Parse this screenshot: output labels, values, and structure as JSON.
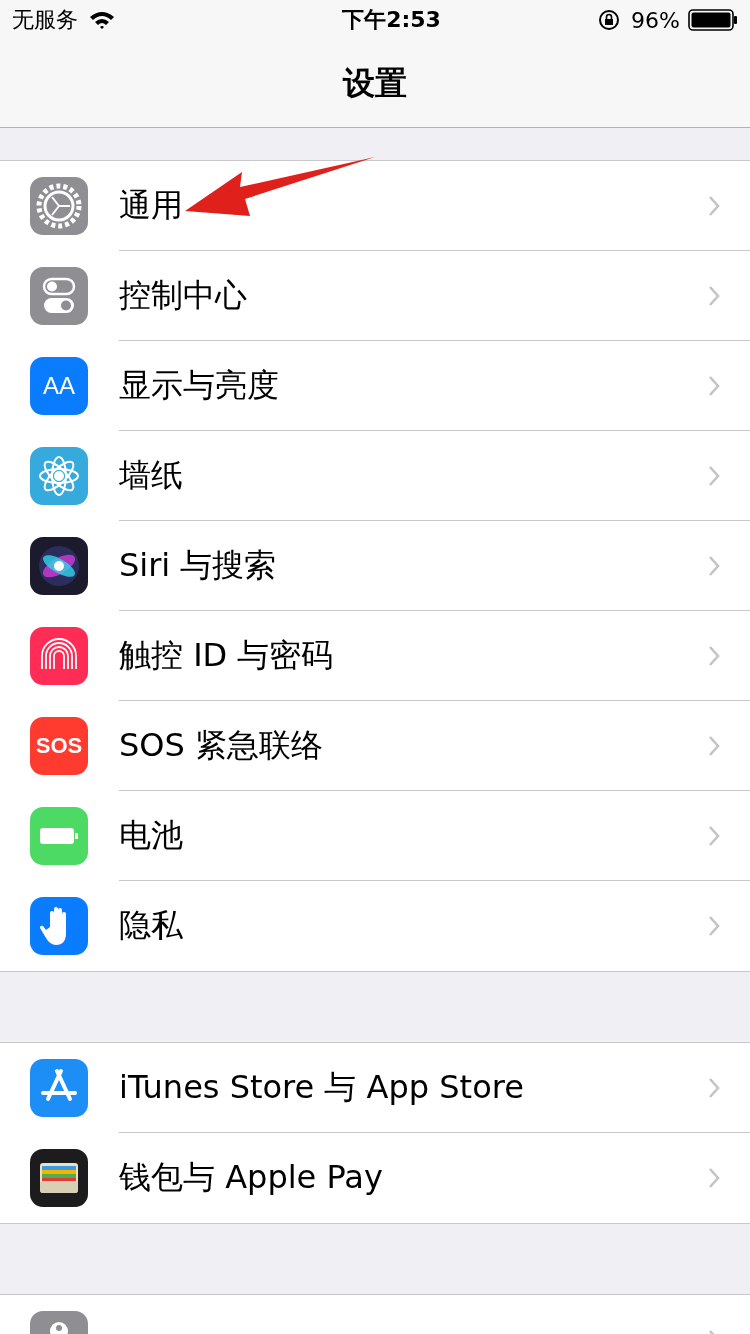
{
  "status_bar": {
    "carrier": "无服务",
    "time": "下午2:53",
    "battery": "96%"
  },
  "nav": {
    "title": "设置"
  },
  "groups": [
    {
      "rows": [
        {
          "label": "通用"
        },
        {
          "label": "控制中心"
        },
        {
          "label": "显示与亮度",
          "icon_text": "AA"
        },
        {
          "label": "墙纸"
        },
        {
          "label": "Siri 与搜索"
        },
        {
          "label": "触控 ID 与密码"
        },
        {
          "label": "SOS 紧急联络",
          "icon_text": "SOS"
        },
        {
          "label": "电池"
        },
        {
          "label": "隐私"
        }
      ]
    },
    {
      "rows": [
        {
          "label": "iTunes Store 与 App Store"
        },
        {
          "label": "钱包与 Apple Pay"
        }
      ]
    },
    {
      "rows": [
        {}
      ]
    }
  ]
}
